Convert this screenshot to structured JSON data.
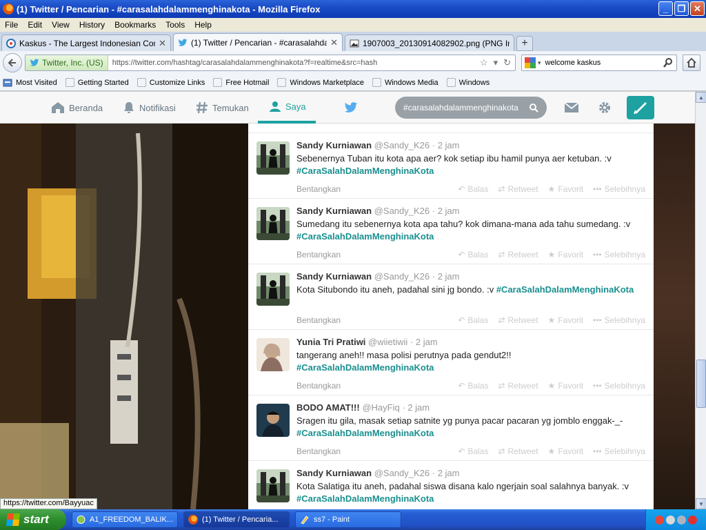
{
  "window": {
    "title": "(1) Twitter / Pencarian - #carasalahdalammenghinakota - Mozilla Firefox",
    "buttons": {
      "minimize": "_",
      "maximize": "❐",
      "close": "✕"
    }
  },
  "menu": [
    "File",
    "Edit",
    "View",
    "History",
    "Bookmarks",
    "Tools",
    "Help"
  ],
  "tabs": [
    {
      "title": "Kaskus - The Largest Indonesian Commu...",
      "close": "✕",
      "icon": "kaskus-icon"
    },
    {
      "title": "(1) Twitter / Pencarian - #carasalahdala...",
      "close": "✕",
      "icon": "twitter-icon"
    },
    {
      "title": "1907003_20130914082902.png (PNG Im...",
      "close": "",
      "icon": "image-icon"
    }
  ],
  "new_tab": "+",
  "nav": {
    "identity": "Twitter, Inc. (US)",
    "url": "https://twitter.com/hashtag/carasalahdalammenghinakota?f=realtime&src=hash",
    "search_value": "welcome kaskus"
  },
  "bookmarks": [
    "Most Visited",
    "Getting Started",
    "Customize Links",
    "Free Hotmail",
    "Windows Marketplace",
    "Windows Media",
    "Windows"
  ],
  "twitter": {
    "nav": [
      "Beranda",
      "Notifikasi",
      "Temukan",
      "Saya"
    ],
    "search_value": "#carasalahdalammenghinakota",
    "expand_label": "Bentangkan",
    "actions": [
      "Balas",
      "Retweet",
      "Favorit",
      "Selebihnya"
    ],
    "tweets": [
      {
        "name": "Sandy Kurniawan",
        "handle": "@Sandy_K26",
        "time": "2 jam",
        "text": "Sebenernya Tuban itu kota apa aer? kok setiap ibu hamil punya aer ketuban. :v ",
        "tag": "#CaraSalahDalamMenghinaKota"
      },
      {
        "name": "Sandy Kurniawan",
        "handle": "@Sandy_K26",
        "time": "2 jam",
        "text": "Sumedang itu sebenernya kota apa tahu? kok dimana-mana ada tahu sumedang. :v ",
        "tag": "#CaraSalahDalamMenghinaKota"
      },
      {
        "name": "Sandy Kurniawan",
        "handle": "@Sandy_K26",
        "time": "2 jam",
        "text": "Kota Situbondo itu aneh, padahal sini jg bondo. :v ",
        "tag": "#CaraSalahDalamMenghinaKota"
      },
      {
        "name": "Yunia Tri Pratiwi",
        "handle": "@wiietiwii",
        "time": "2 jam",
        "text": "tangerang aneh!! masa polisi perutnya pada gendut2!! ",
        "tag": "#CaraSalahDalamMenghinaKota"
      },
      {
        "name": "BODO AMAT!!!",
        "handle": "@HayFiq",
        "time": "2 jam",
        "text": "Sragen itu gila, masak setiap satnite yg punya pacar pacaran yg jomblo enggak-_- ",
        "tag": "#CaraSalahDalamMenghinaKota"
      },
      {
        "name": "Sandy Kurniawan",
        "handle": "@Sandy_K26",
        "time": "2 jam",
        "text": "Kota Salatiga itu aneh, padahal siswa disana kalo ngerjain soal salahnya banyak. :v ",
        "tag": "#CaraSalahDalamMenghinaKota"
      }
    ]
  },
  "status_url": "https://twitter.com/Bayyuac",
  "taskbar": {
    "start": "start",
    "tasks": [
      "A1_FREEDOM_BALIK...",
      "(1) Twitter / Pencaria...",
      "ss7 - Paint"
    ]
  },
  "colors": {
    "twitter_accent": "#1da1a1",
    "xp_blue": "#245ed4",
    "start_green": "#2f8f2f"
  }
}
